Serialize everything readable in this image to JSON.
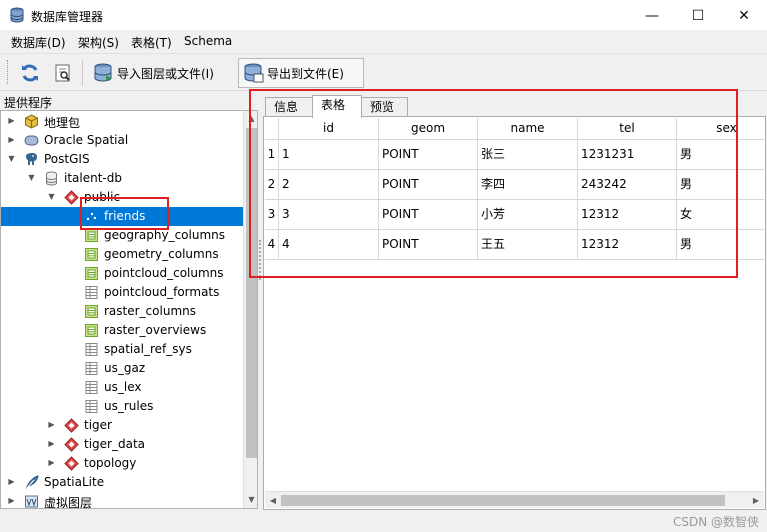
{
  "window": {
    "title": "数据库管理器",
    "controls": {
      "minimize": "—",
      "maximize": "☐",
      "close": "✕"
    }
  },
  "menu": [
    "数据库(D)",
    "架构(S)",
    "表格(T)",
    "Schema"
  ],
  "toolbar": {
    "refresh_icon": "refresh-icon",
    "info_icon": "info-icon",
    "import_label": "导入图层或文件(I)",
    "export_label": "导出到文件(E)"
  },
  "left_panel": {
    "title": "提供程序"
  },
  "tree": [
    {
      "label": "地理包",
      "icon": "geopackage-icon",
      "expanded": false
    },
    {
      "label": "Oracle Spatial",
      "icon": "oracle-icon",
      "expanded": false
    },
    {
      "label": "PostGIS",
      "icon": "elephant-icon",
      "expanded": true
    },
    {
      "label": "italent-db",
      "icon": "database-icon",
      "expanded": true
    },
    {
      "label": "public",
      "icon": "schema-icon",
      "expanded": true
    },
    {
      "label": "friends",
      "icon": "point-layer-icon",
      "selected": true
    },
    {
      "label": "geography_columns",
      "icon": "table-icon"
    },
    {
      "label": "geometry_columns",
      "icon": "table-icon"
    },
    {
      "label": "pointcloud_columns",
      "icon": "table-icon"
    },
    {
      "label": "pointcloud_formats",
      "icon": "plain-table-icon"
    },
    {
      "label": "raster_columns",
      "icon": "table-icon"
    },
    {
      "label": "raster_overviews",
      "icon": "table-icon"
    },
    {
      "label": "spatial_ref_sys",
      "icon": "plain-table-icon"
    },
    {
      "label": "us_gaz",
      "icon": "plain-table-icon"
    },
    {
      "label": "us_lex",
      "icon": "plain-table-icon"
    },
    {
      "label": "us_rules",
      "icon": "plain-table-icon"
    },
    {
      "label": "tiger",
      "icon": "schema-icon",
      "expanded": false
    },
    {
      "label": "tiger_data",
      "icon": "schema-icon",
      "expanded": false
    },
    {
      "label": "topology",
      "icon": "schema-icon",
      "expanded": false
    },
    {
      "label": "SpatiaLite",
      "icon": "feather-icon",
      "expanded": false
    },
    {
      "label": "虚拟图层",
      "icon": "virtual-layer-icon",
      "expanded": false
    }
  ],
  "tabs": [
    "信息",
    "表格",
    "预览"
  ],
  "active_tab": "表格",
  "table": {
    "columns": [
      "id",
      "geom",
      "name",
      "tel",
      "sex"
    ],
    "row_numbers": [
      "1",
      "2",
      "3",
      "4"
    ],
    "rows": [
      [
        "1",
        "POINT",
        "张三",
        "1231231",
        "男"
      ],
      [
        "2",
        "POINT",
        "李四",
        "243242",
        "男"
      ],
      [
        "3",
        "POINT",
        "小芳",
        "12312",
        "女"
      ],
      [
        "4",
        "POINT",
        "王五",
        "12312",
        "男"
      ]
    ]
  },
  "watermark": "CSDN @数智侠",
  "colors": {
    "selection": "#0078d7",
    "annotation_red": "#e02020",
    "table_icon_green": "#8cc63f",
    "schema_red": "#d9534f"
  }
}
